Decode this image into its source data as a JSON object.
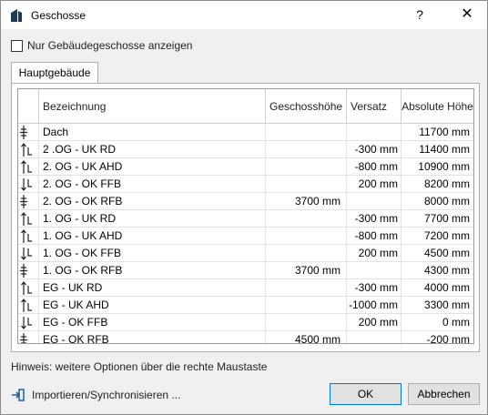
{
  "window": {
    "title": "Geschosse",
    "help": "?",
    "close": "✕"
  },
  "options": {
    "only_main_label": "Nur Gebäudegeschosse anzeigen"
  },
  "tabs": [
    {
      "label": "Hauptgebäude"
    }
  ],
  "table": {
    "columns": [
      "Bezeichnung",
      "Geschosshöhe",
      "Versatz",
      "Absolute Höhe"
    ],
    "rows": [
      {
        "name": "Dach",
        "hoehe": "",
        "versatz": "",
        "absolut": "11700 mm",
        "icon": "main"
      },
      {
        "name": "2 .OG - UK RD",
        "hoehe": "",
        "versatz": "-300 mm",
        "absolut": "11400 mm",
        "icon": "up"
      },
      {
        "name": "2. OG - UK AHD",
        "hoehe": "",
        "versatz": "-800 mm",
        "absolut": "10900 mm",
        "icon": "up"
      },
      {
        "name": "2. OG - OK FFB",
        "hoehe": "",
        "versatz": "200 mm",
        "absolut": "8200 mm",
        "icon": "down"
      },
      {
        "name": "2. OG - OK RFB",
        "hoehe": "3700 mm",
        "versatz": "",
        "absolut": "8000 mm",
        "icon": "main"
      },
      {
        "name": "1. OG - UK RD",
        "hoehe": "",
        "versatz": "-300 mm",
        "absolut": "7700 mm",
        "icon": "up"
      },
      {
        "name": "1. OG - UK AHD",
        "hoehe": "",
        "versatz": "-800 mm",
        "absolut": "7200 mm",
        "icon": "up"
      },
      {
        "name": "1. OG - OK FFB",
        "hoehe": "",
        "versatz": "200 mm",
        "absolut": "4500 mm",
        "icon": "down"
      },
      {
        "name": "1. OG - OK RFB",
        "hoehe": "3700 mm",
        "versatz": "",
        "absolut": "4300 mm",
        "icon": "main"
      },
      {
        "name": "EG - UK RD",
        "hoehe": "",
        "versatz": "-300 mm",
        "absolut": "4000 mm",
        "icon": "up"
      },
      {
        "name": "EG - UK AHD",
        "hoehe": "",
        "versatz": "-1000 mm",
        "absolut": "3300 mm",
        "icon": "up"
      },
      {
        "name": "EG - OK FFB",
        "hoehe": "",
        "versatz": "200 mm",
        "absolut": "0 mm",
        "icon": "down"
      },
      {
        "name": "EG - OK RFB",
        "hoehe": "4500 mm",
        "versatz": "",
        "absolut": "-200 mm",
        "icon": "main"
      }
    ]
  },
  "hint": "Hinweis: weitere Optionen über die rechte Maustaste",
  "footer": {
    "import_label": "Importieren/Synchronisieren ...",
    "ok_label": "OK",
    "cancel_label": "Abbrechen"
  },
  "colors": {
    "highlight": "#e0313a",
    "accent": "#0078d7"
  }
}
